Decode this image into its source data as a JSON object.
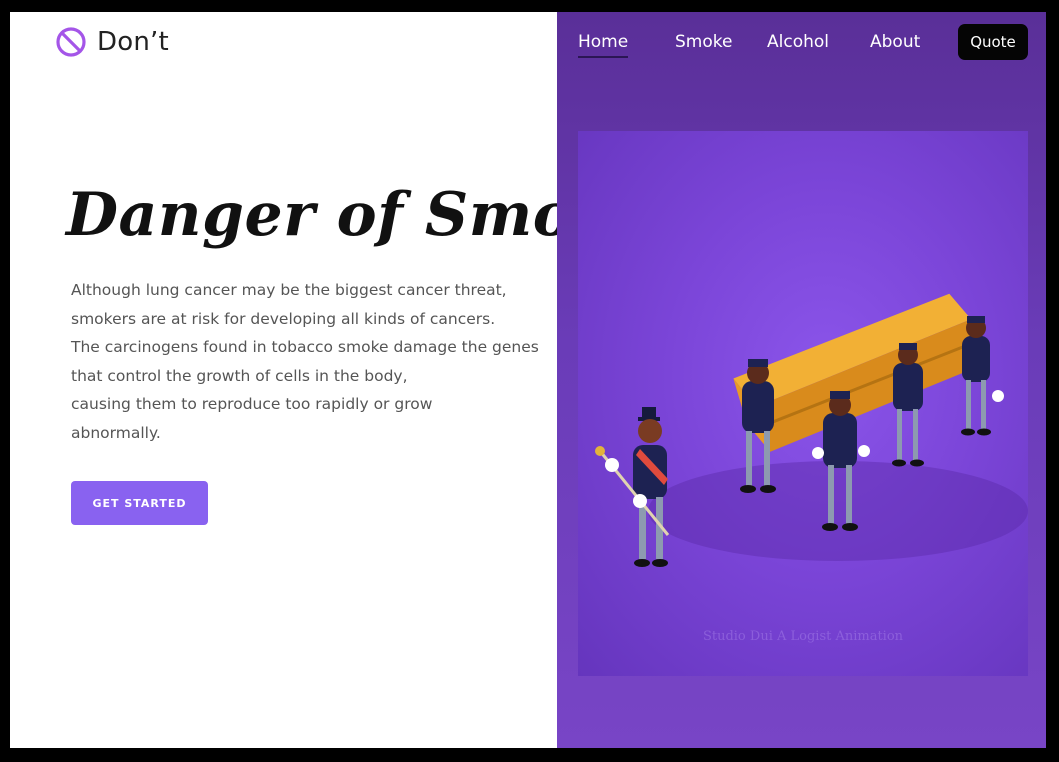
{
  "brand": {
    "name": "Don’t",
    "icon": "prohibited-icon",
    "accent": "#a455e8"
  },
  "nav": {
    "items": [
      {
        "label": "Home",
        "active": true
      },
      {
        "label": "Smoke",
        "active": false
      },
      {
        "label": "Alcohol",
        "active": false
      },
      {
        "label": "About",
        "active": false
      }
    ],
    "quote_label": "Quote"
  },
  "hero": {
    "title": "Danger of Smoking",
    "lines": [
      "Although lung cancer may be the biggest cancer threat,",
      "smokers are at risk for developing all kinds of cancers.",
      "The carcinogens found in tobacco smoke damage the genes",
      "that control the growth of cells in the body,",
      "causing them to reproduce too rapidly or grow",
      "abnormally."
    ],
    "cta_label": "GET STARTED"
  },
  "illustration": {
    "subject": "coffin-dance",
    "watermark": "Studio Dui A Logist Animation"
  },
  "colors": {
    "panel": "#6a3cb8",
    "button": "#8962f0",
    "quote_button": "#050505"
  }
}
